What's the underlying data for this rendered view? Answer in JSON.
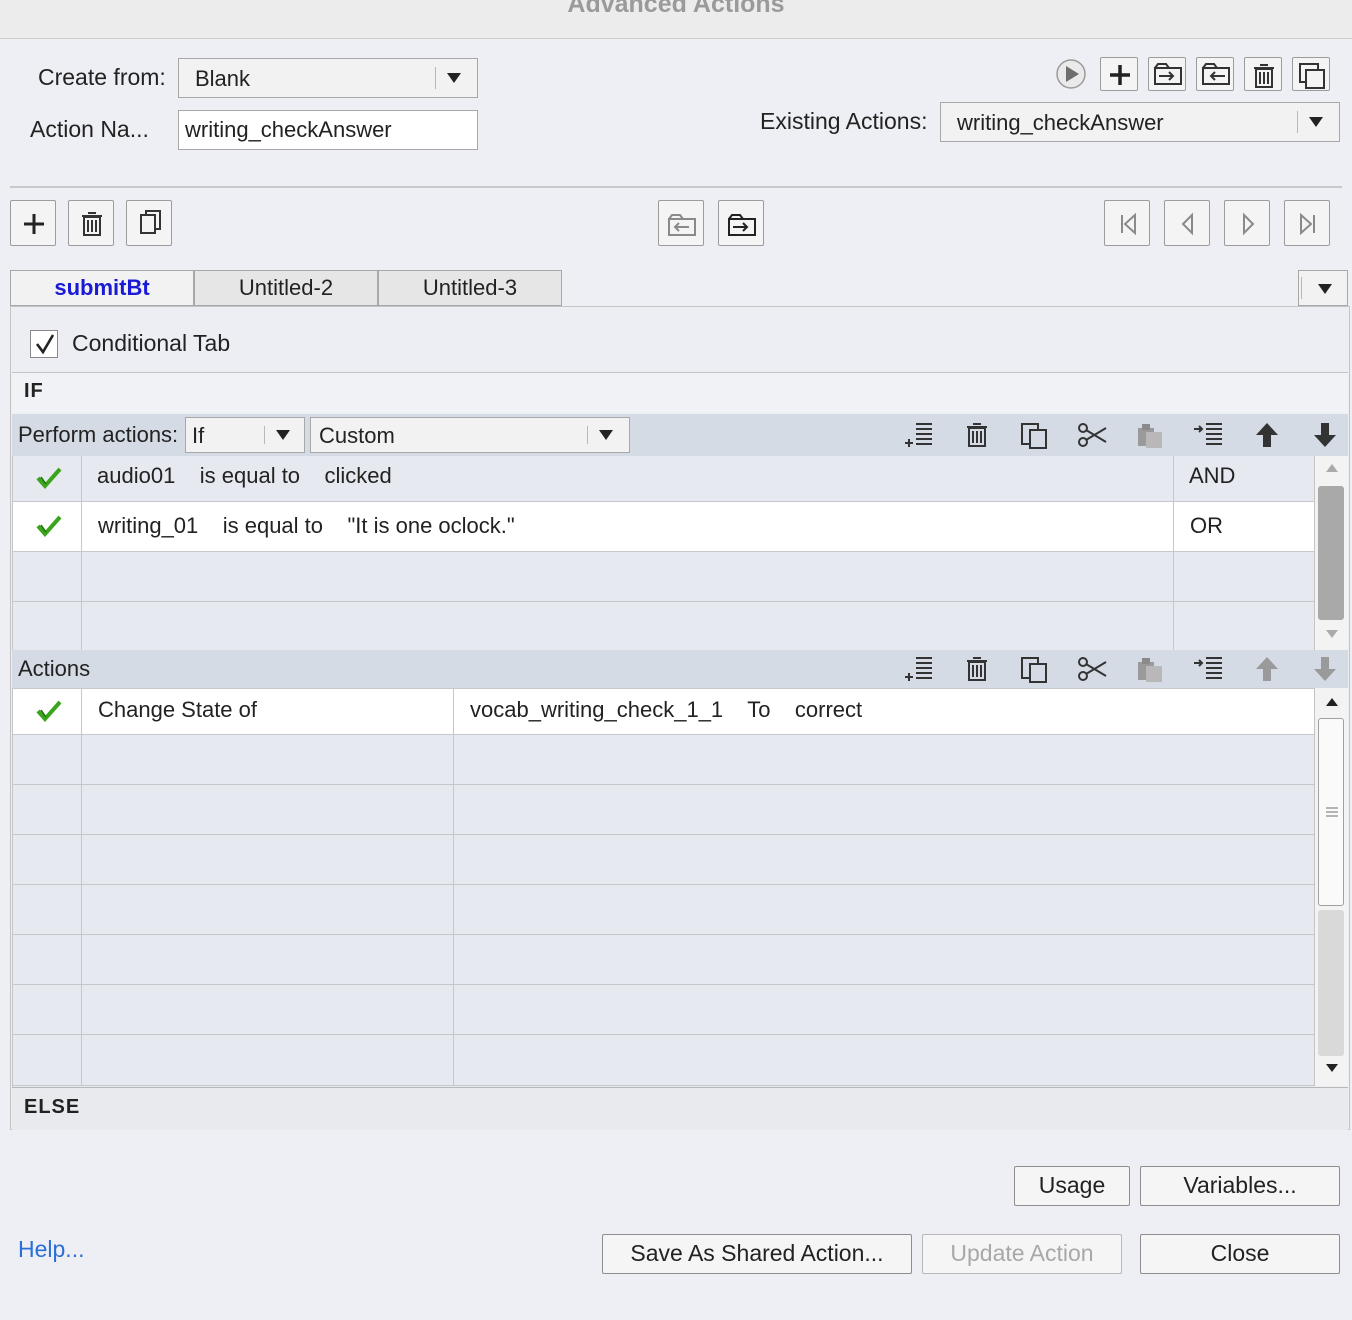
{
  "window": {
    "title": "Advanced Actions"
  },
  "header": {
    "create_from_label": "Create from:",
    "create_from_value": "Blank",
    "action_name_label": "Action Na...",
    "action_name_value": "writing_checkAnswer",
    "existing_actions_label": "Existing Actions:",
    "existing_actions_value": "writing_checkAnswer"
  },
  "tabs": [
    {
      "label": "submitBt",
      "active": true
    },
    {
      "label": "Untitled-2",
      "active": false
    },
    {
      "label": "Untitled-3",
      "active": false
    }
  ],
  "conditional_tab": {
    "label": "Conditional Tab",
    "checked": true
  },
  "if_section": {
    "header": "IF",
    "perform_label": "Perform actions:",
    "perform_value": "If",
    "condition_type": "Custom",
    "conditions": [
      {
        "text": "audio01    is equal to    clicked",
        "operator": "AND",
        "valid": true
      },
      {
        "text": "writing_01    is equal to    \"It is one oclock.\"",
        "operator": "OR",
        "valid": true
      }
    ]
  },
  "actions_section": {
    "header": "Actions",
    "rows": [
      {
        "action": "Change State of",
        "target": "vocab_writing_check_1_1    To    correct",
        "valid": true
      }
    ]
  },
  "else_section": {
    "header": "ELSE"
  },
  "footer": {
    "usage": "Usage",
    "variables": "Variables...",
    "help": "Help...",
    "save_shared": "Save As Shared Action...",
    "update": "Update Action",
    "close": "Close"
  },
  "colors": {
    "accent_tab": "#1a1ad6",
    "check_green": "#3aa51c",
    "link": "#2a6fd6"
  }
}
